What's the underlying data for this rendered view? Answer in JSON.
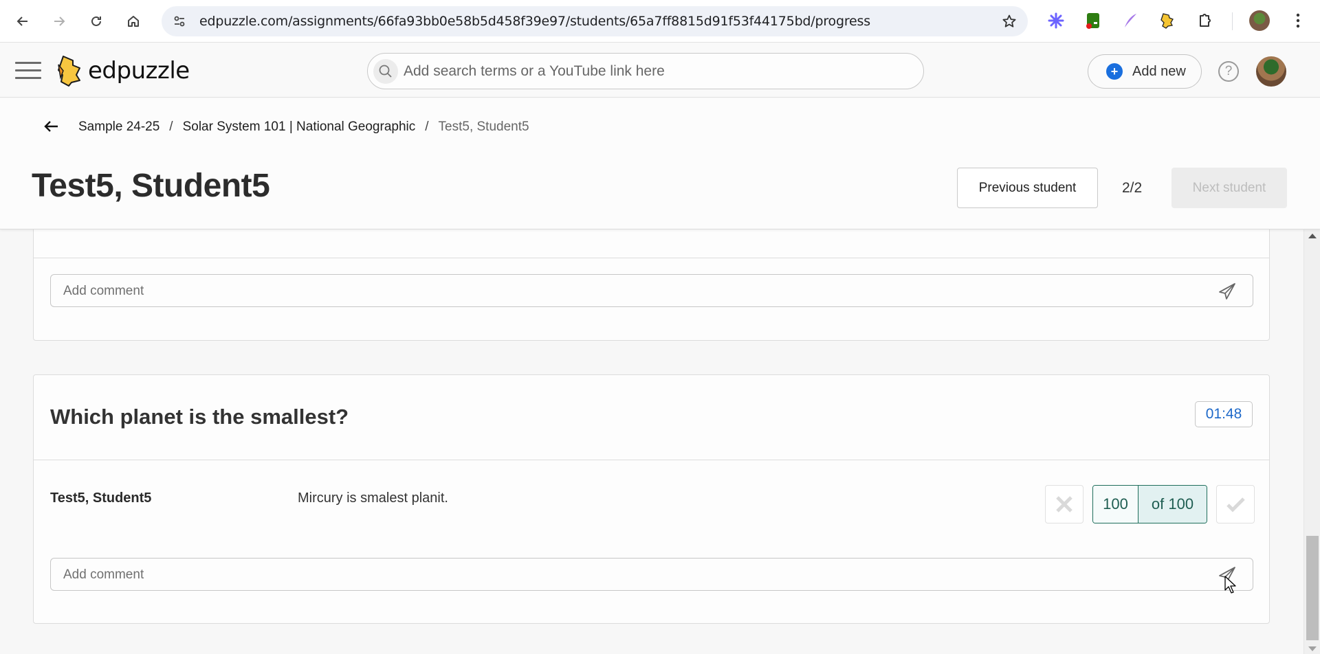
{
  "browser": {
    "url": "edpuzzle.com/assignments/66fa93bb0e58b5d458f39e97/students/65a7ff8815d91f53f44175bd/progress",
    "nav": {
      "back_icon": "arrow-left-icon",
      "forward_icon": "arrow-right-icon",
      "reload_icon": "reload-icon",
      "home_icon": "home-icon"
    },
    "extensions": [
      "perplexity-extension-icon",
      "green-extension-icon",
      "quill-extension-icon",
      "edpuzzle-extension-icon",
      "extensions-puzzle-icon"
    ]
  },
  "app": {
    "brand": "edpuzzle",
    "search": {
      "placeholder": "Add search terms or a YouTube link here",
      "value": ""
    },
    "add_new_label": "Add new",
    "help_label": "?",
    "accent_color": "#1a6fde"
  },
  "page": {
    "breadcrumb": [
      {
        "label": "Sample 24-25"
      },
      {
        "label": "Solar System 101 | National Geographic"
      },
      {
        "label": "Test5, Student5"
      }
    ],
    "separator": "/",
    "student_name": "Test5, Student5",
    "pager": {
      "previous_label": "Previous student",
      "counter": "2/2",
      "next_label": "Next student",
      "next_disabled": true
    }
  },
  "cards": [
    {
      "comment_placeholder": "Add comment",
      "comment_value": ""
    },
    {
      "question": "Which planet is the smallest?",
      "timestamp": "01:48",
      "answer": {
        "student": "Test5, Student5",
        "text": "Mircury is smalest planit.",
        "score": "100",
        "out_of": "of 100"
      },
      "comment_placeholder": "Add comment",
      "comment_value": ""
    }
  ]
}
